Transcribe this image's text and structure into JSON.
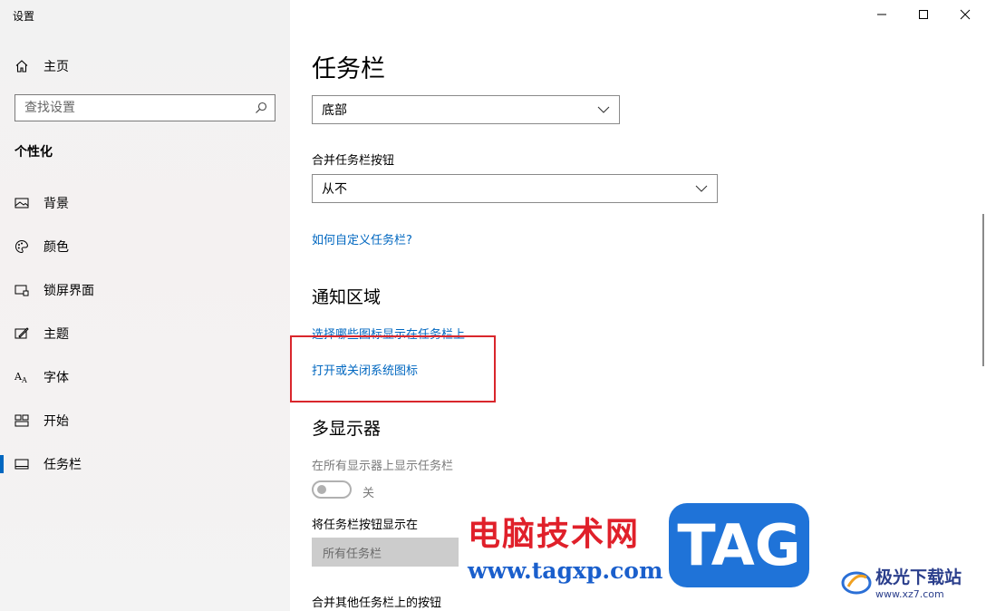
{
  "window": {
    "title": "设置"
  },
  "sidebar": {
    "home_label": "主页",
    "search_placeholder": "查找设置",
    "section_title": "个性化",
    "items": [
      {
        "label": "背景",
        "icon": "image-icon"
      },
      {
        "label": "颜色",
        "icon": "palette-icon"
      },
      {
        "label": "锁屏界面",
        "icon": "lock-screen-icon"
      },
      {
        "label": "主题",
        "icon": "theme-icon"
      },
      {
        "label": "字体",
        "icon": "font-icon"
      },
      {
        "label": "开始",
        "icon": "start-icon"
      },
      {
        "label": "任务栏",
        "icon": "taskbar-icon",
        "active": true
      }
    ]
  },
  "main": {
    "title": "任务栏",
    "position_select": "底部",
    "combine_label": "合并任务栏按钮",
    "combine_select": "从不",
    "customize_link": "如何自定义任务栏?",
    "notification_heading": "通知区域",
    "select_icons_link": "选择哪些图标显示在任务栏上",
    "system_icons_link": "打开或关闭系统图标",
    "multi_display_heading": "多显示器",
    "show_all_label": "在所有显示器上显示任务栏",
    "toggle_state": "关",
    "show_buttons_label": "将任务栏按钮显示在",
    "show_buttons_select": "所有任务栏",
    "combine_other_label": "合并其他任务栏上的按钮"
  },
  "watermark": {
    "cn": "电脑技术网",
    "url": "www.tagxp.com",
    "tag": "TAG",
    "brand": "极光下载站",
    "brand_url": "www.xz7.com"
  },
  "colors": {
    "accent": "#0067c0",
    "highlight": "#d9262c"
  }
}
